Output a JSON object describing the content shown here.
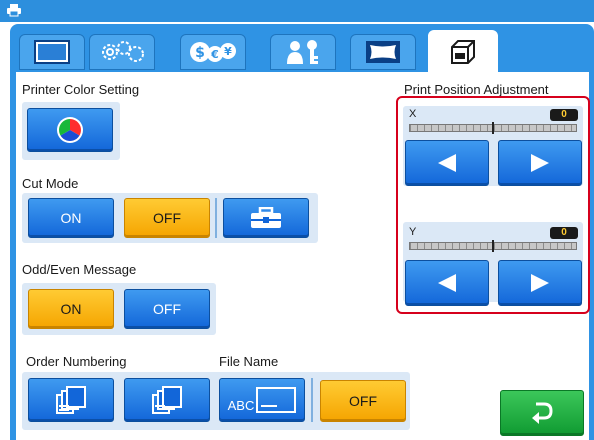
{
  "tabs": [
    {
      "icon": "screen-icon"
    },
    {
      "icon": "gears-icon"
    },
    {
      "icon": "currency-icon"
    },
    {
      "icon": "user-key-icon"
    },
    {
      "icon": "frame-icon"
    },
    {
      "icon": "cut-paper-icon",
      "active": true
    }
  ],
  "printer_color": {
    "label": "Printer Color Setting",
    "icon": "color-wheel-icon"
  },
  "cut_mode": {
    "label": "Cut Mode",
    "on": "ON",
    "off": "OFF",
    "selected": "OFF",
    "tool_icon": "toolbox-icon"
  },
  "odd_even": {
    "label": "Odd/Even Message",
    "on": "ON",
    "off": "OFF",
    "selected": "ON"
  },
  "order_numbering": {
    "label": "Order Numbering"
  },
  "file_name": {
    "label": "File Name",
    "abc_label": "ABC",
    "off": "OFF"
  },
  "print_position": {
    "title": "Print Position Adjustment",
    "x": {
      "label": "X",
      "value": "0",
      "level": 0.5
    },
    "y": {
      "label": "Y",
      "value": "0",
      "level": 0.5
    }
  },
  "colors": {
    "accent_blue": "#2f93e4",
    "selected_orange": "#f5a400",
    "highlight_red": "#d6001c",
    "back_green": "#0f9a31"
  }
}
